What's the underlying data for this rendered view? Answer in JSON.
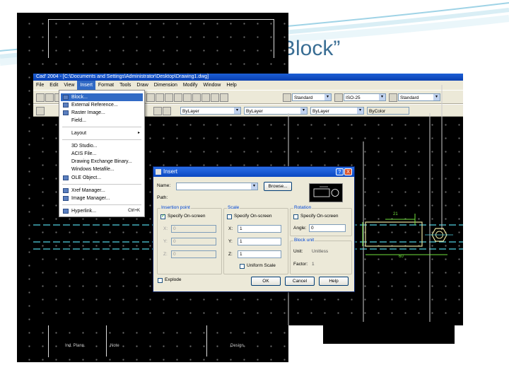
{
  "slide": {
    "title": "Block”"
  },
  "back_drawing": {
    "title_block": [
      "Ind. Plann.",
      "Note",
      "Design"
    ]
  },
  "app": {
    "title": "Cad' 2004 - [C:\\Documents and Settings\\Administrator\\Desktop\\Drawing1.dwg]",
    "menu": [
      "File",
      "Edit",
      "View",
      "Insert",
      "Format",
      "Tools",
      "Draw",
      "Dimension",
      "Modify",
      "Window",
      "Help"
    ],
    "open_menu_index": 3,
    "toolbar1": {
      "text_style": "Standard",
      "dim_style": "ISO-25",
      "table_style": "Standard"
    },
    "toolbar2": {
      "layer": "ByLayer",
      "linetype": "ByLayer",
      "lineweight": "ByLayer",
      "plotstyle": "ByColor"
    }
  },
  "insert_menu": {
    "items": [
      {
        "label": "Block...",
        "highlighted": true,
        "icon": "block-icon"
      },
      {
        "label": "External Reference...",
        "icon": "xref-icon"
      },
      {
        "label": "Raster Image...",
        "icon": "image-icon"
      },
      {
        "label": "Field...",
        "icon": ""
      },
      {
        "label": "Layout",
        "submenu": true,
        "icon": ""
      },
      {
        "label": "3D Studio...",
        "icon": ""
      },
      {
        "label": "ACIS File...",
        "icon": ""
      },
      {
        "label": "Drawing Exchange Binary...",
        "icon": ""
      },
      {
        "label": "Windows Metafile...",
        "icon": ""
      },
      {
        "label": "OLE Object...",
        "icon": "ole-icon"
      },
      {
        "label": "Xref Manager...",
        "icon": "xref-manager-icon"
      },
      {
        "label": "Image Manager...",
        "icon": "image-manager-icon"
      },
      {
        "label": "Hyperlink...",
        "shortcut": "Ctrl+K",
        "icon": "hyperlink-icon"
      }
    ]
  },
  "insert_dialog": {
    "title": "Insert",
    "name_label": "Name:",
    "name_value": "",
    "browse_label": "Browse...",
    "path_label": "Path:",
    "insertion_point": {
      "title": "Insertion point",
      "specify_label": "Specify On-screen",
      "specify_checked": true,
      "x_label": "X:",
      "x_value": "0",
      "y_label": "Y:",
      "y_value": "0",
      "z_label": "Z:",
      "z_value": "0"
    },
    "scale": {
      "title": "Scale",
      "specify_label": "Specify On-screen",
      "specify_checked": false,
      "x_label": "X:",
      "x_value": "1",
      "y_label": "Y:",
      "y_value": "1",
      "z_label": "Z:",
      "z_value": "1",
      "uniform_label": "Uniform Scale",
      "uniform_checked": false
    },
    "rotation": {
      "title": "Rotation",
      "specify_label": "Specify On-screen",
      "specify_checked": false,
      "angle_label": "Angle:",
      "angle_value": "0"
    },
    "block_unit": {
      "title": "Block unit",
      "unit_label": "Unit:",
      "unit_value": "Unitless",
      "factor_label": "Factor:",
      "factor_value": "1"
    },
    "explode_label": "Explode",
    "explode_checked": false,
    "ok_label": "OK",
    "cancel_label": "Cancel",
    "help_label": "Help",
    "help_button": "?",
    "close_button": "X"
  },
  "dimension_drawing": {
    "width_value": "60",
    "top_value": "21",
    "color": "#6fe03c"
  }
}
